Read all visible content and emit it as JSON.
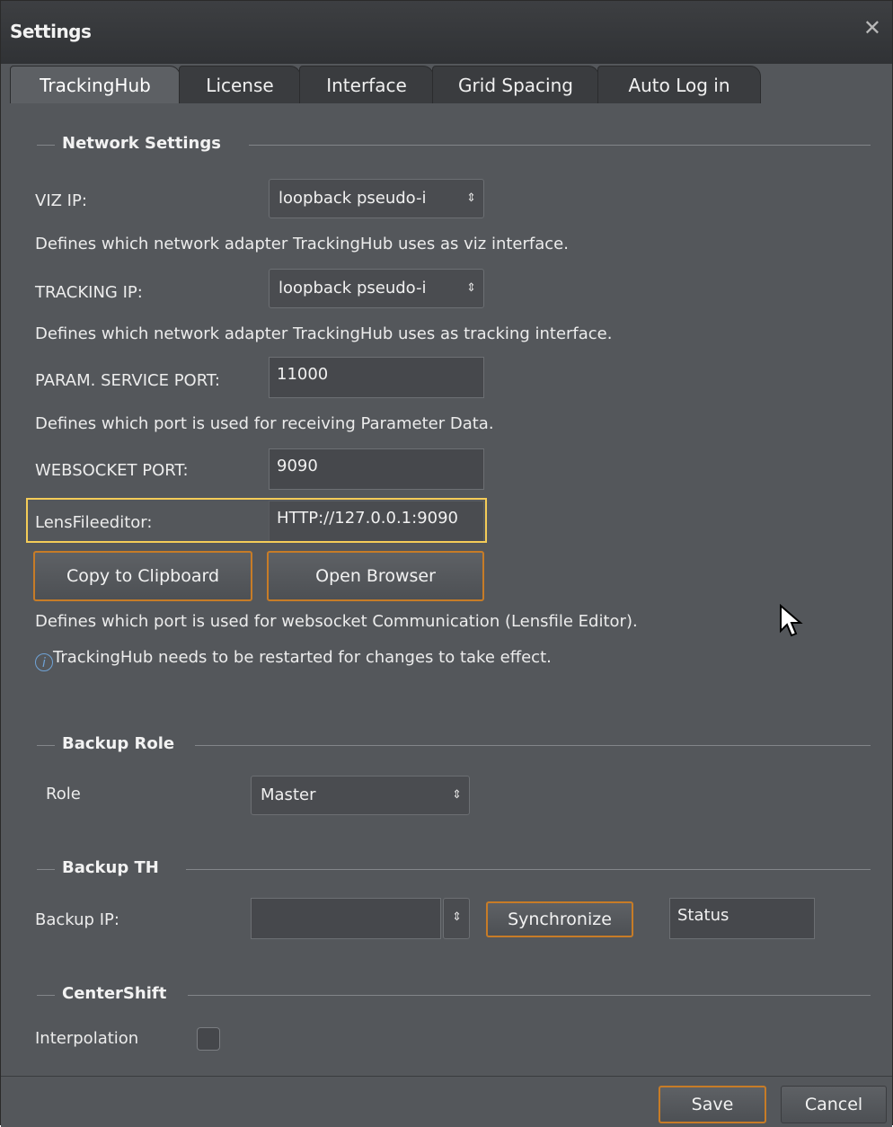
{
  "window": {
    "title": "Settings",
    "close_glyph": "✕"
  },
  "tabs": [
    {
      "label": "TrackingHub",
      "active": true
    },
    {
      "label": "License",
      "active": false
    },
    {
      "label": "Interface",
      "active": false
    },
    {
      "label": "Grid Spacing",
      "active": false
    },
    {
      "label": "Auto Log in",
      "active": false
    }
  ],
  "network": {
    "heading": "Network Settings",
    "viz_ip_label": "VIZ IP:",
    "viz_ip_value": "loopback pseudo-i",
    "viz_ip_desc": "Defines which network adapter TrackingHub uses as viz interface.",
    "tracking_ip_label": "TRACKING IP:",
    "tracking_ip_value": "loopback pseudo-i",
    "tracking_ip_desc": "Defines which network adapter TrackingHub uses as tracking interface.",
    "param_port_label": "PARAM. SERVICE PORT:",
    "param_port_value": "11000",
    "param_port_desc": "Defines which port is used for receiving Parameter Data.",
    "websocket_label": "WEBSOCKET PORT:",
    "websocket_value": "9090",
    "lensfile_label": "LensFileeditor:",
    "lensfile_value": "HTTP://127.0.0.1:9090",
    "copy_label": "Copy to Clipboard",
    "open_browser_label": "Open Browser",
    "websocket_desc": "Defines which port is used for websocket Communication (Lensfile Editor).",
    "restart_note": "TrackingHub needs to be restarted for changes to take effect.",
    "info_glyph": "i"
  },
  "backup_role": {
    "heading": "Backup Role",
    "role_label": "Role",
    "role_value": "Master"
  },
  "backup_th": {
    "heading": "Backup TH",
    "ip_label": "Backup IP:",
    "ip_value": "",
    "sync_label": "Synchronize",
    "status_value": "Status"
  },
  "centershift": {
    "heading": "CenterShift",
    "interpolation_label": "Interpolation",
    "interpolation_checked": false
  },
  "footer": {
    "save_label": "Save",
    "cancel_label": "Cancel"
  },
  "icons": {
    "select_arrows": "⇕"
  },
  "colors": {
    "accent": "#c77c27",
    "highlight": "#f4cc58",
    "background": "#54575b"
  }
}
